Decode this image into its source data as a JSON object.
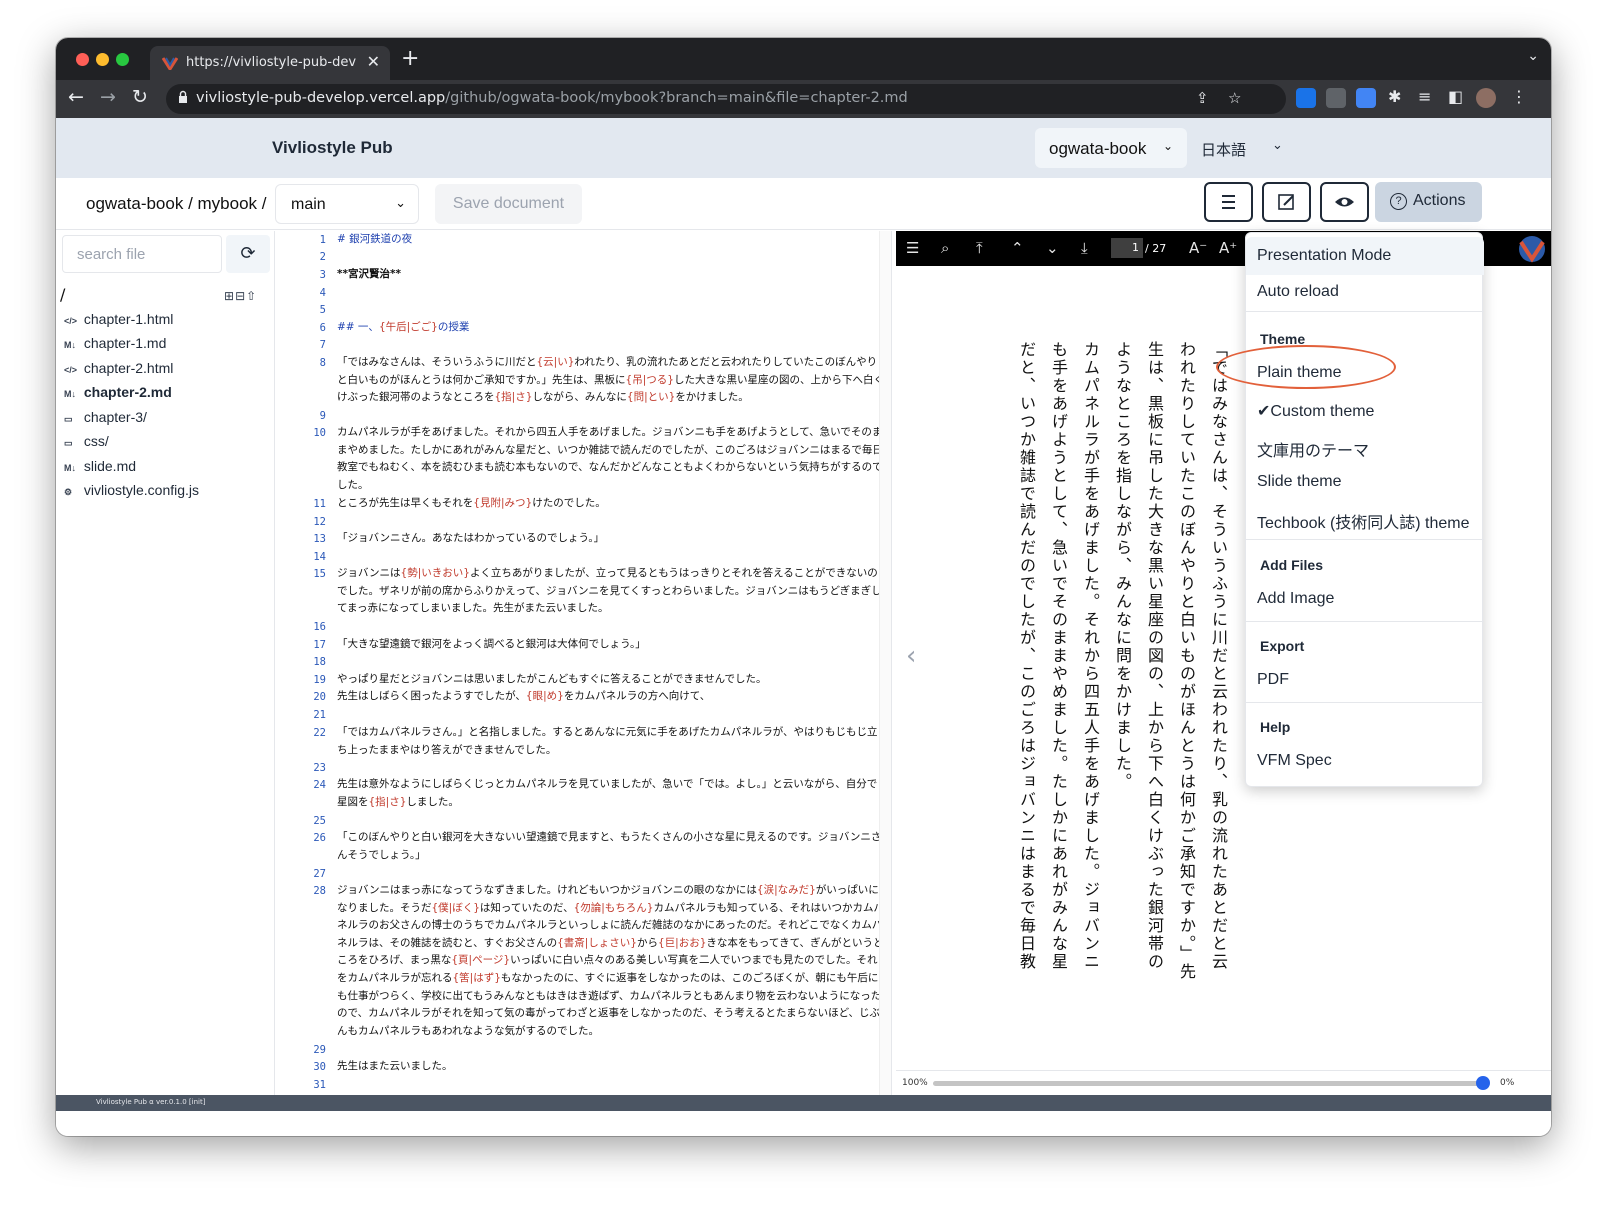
{
  "browser": {
    "tab_title": "https://vivliostyle-pub-develop",
    "tab_close": "✕",
    "new_tab": "+",
    "url_domain": "vivliostyle-pub-develop.vercel.app",
    "url_path": "/github/ogwata-book/mybook?branch=main&file=chapter-2.md"
  },
  "header": {
    "brand": "Vivliostyle Pub",
    "user": "ogwata-book",
    "language": "日本語"
  },
  "toolbar": {
    "repo_path": "ogwata-book / mybook /",
    "branch": "main",
    "save_label": "Save document",
    "actions_label": "Actions"
  },
  "sidebar": {
    "search_placeholder": "search file",
    "root": "/",
    "files": [
      {
        "name": "chapter-1.html",
        "icon": "</>"
      },
      {
        "name": "chapter-1.md",
        "icon": "M↓"
      },
      {
        "name": "chapter-2.html",
        "icon": "</>"
      },
      {
        "name": "chapter-2.md",
        "icon": "M↓"
      },
      {
        "name": "chapter-3/",
        "icon": "▭"
      },
      {
        "name": "css/",
        "icon": "▭"
      },
      {
        "name": "slide.md",
        "icon": "M↓"
      },
      {
        "name": "vivliostyle.config.js",
        "icon": "⚙"
      }
    ],
    "version": "Vivliostyle Pub α ver.0.1.0 [init]"
  },
  "editor": {
    "line_numbers": [
      "1",
      "2",
      "3",
      "4",
      "5",
      "6",
      "7",
      "8",
      "9",
      "10",
      "11",
      "12",
      "13",
      "14",
      "15",
      "16",
      "17",
      "18",
      "19",
      "20",
      "21",
      "22",
      "23",
      "24",
      "25",
      "26",
      "27",
      "28",
      "29",
      "30",
      "31"
    ],
    "lines": [
      "# 銀河鉄道の夜",
      "**宮沢賢治**",
      "## 一、{午后|ごご}の授業",
      "「ではみなさんは、そういうふうに川だと{云|い}われたり、乳の流れたあとだと云われたりしていたこのぼんやりと白いものがほんとうは何かご承知ですか。」先生は、黒板に{吊|つる}した大きな黒い星座の図の、上から下へ白くけぶった銀河帯のようなところを{指|さ}しながら、みんなに{問|とい}をかけました。",
      "カムパネルラが手をあげました。それから四五人手をあげました。ジョバンニも手をあげようとして、急いでそのままやめました。たしかにあれがみんな星だと、いつか雑誌で読んだのでしたが、このごろはジョバンニはまるで毎日教室でもねむく、本を読むひまも読む本もないので、なんだかどんなこともよくわからないという気持ちがするのでした。",
      "ところが先生は早くもそれを{見附|みつ}けたのでした。",
      "「ジョバンニさん。あなたはわかっているのでしょう。」",
      "ジョバンニは{勢|いきおい}よく立ちあがりましたが、立って見るともうはっきりとそれを答えることができないのでした。ザネリが前の席からふりかえって、ジョバンニを見てくすっとわらいました。ジョバンニはもうどぎまぎしてまっ赤になってしまいました。先生がまた云いました。",
      "「大きな望遠鏡で銀河をよっく調べると銀河は大体何でしょう。」",
      "やっぱり星だとジョバンニは思いましたがこんどもすぐに答えることができませんでした。",
      "先生はしばらく困ったようすでしたが、{眼|め}をカムパネルラの方へ向けて、",
      "「ではカムパネルラさん。」と名指しました。するとあんなに元気に手をあげたカムパネルラが、やはりもじもじ立ち上ったままやはり答えができませんでした。",
      "先生は意外なようにしばらくじっとカムパネルラを見ていましたが、急いで「では。よし。」と云いながら、自分で星図を{指|さ}しました。",
      "「このぼんやりと白い銀河を大きないい望遠鏡で見ますと、もうたくさんの小さな星に見えるのです。ジョバンニさんそうでしょう。」",
      "ジョバンニはまっ赤になってうなずきました。けれどもいつかジョバンニの眼のなかには{涙|なみだ}がいっぱいになりました。そうだ{僕|ぼく}は知っていたのだ、{勿論|もちろん}カムパネルラも知っている、それはいつかカムパネルラのお父さんの博士のうちでカムパネルラといっしょに読んだ雑誌のなかにあったのだ。それどこでなくカムパネルラは、その雑誌を読むと、すぐお父さんの{書斎|しょさい}から{巨|おお}きな本をもってきて、ぎんがというところをひろげ、まっ黒な{頁|ページ}いっぱいに白い点々のある美しい写真を二人でいつまでも見たのでした。それをカムパネルラが忘れる{筈|はず}もなかったのに、すぐに返事をしなかったのは、このごろぼくが、朝にも午后にも仕事がつらく、学校に出てもうみんなともはきはき遊ばず、カムパネルラともあんまり物を云わないようになったので、カムパネルラがそれを知って気の毒がってわざと返事をしなかったのだ、そう考えるとたまらないほど、じぶんもカムパネルラもあわれなような気がするのでした。",
      "先生はまた云いました。"
    ]
  },
  "viewer": {
    "page_current": "1",
    "page_total": "/ 27",
    "zoom_left": "100%",
    "zoom_right": "0%",
    "zoom_level": 1.0,
    "vertical_paragraphs": [
      "「ではみなさんは、そういうふうに川だと云われたり、乳の流れたあとだと云われたりしていたこのぼんやりと白いものがほんとうは何かご承知ですか。」先生は、黒板に吊した大きな黒い星座の図の、上から下へ白くけぶった銀河帯のようなところを指しながら、みんなに問をかけました。",
      "カムパネルラが手をあげました。それから四五人手をあげました。ジョバンニも手をあげようとして、急いでそのままやめました。たしかにあれがみんな星だと、いつか雑誌で読んだのでしたが、このごろはジョバンニはまるで毎日教室でもねむく、本を読むひまも読む本"
    ]
  },
  "actions_menu": {
    "presentation_mode": "Presentation Mode",
    "auto_reload": "Auto reload",
    "theme_header": "Theme",
    "themes": [
      "Plain theme",
      "Custom theme",
      "文庫用のテーマ",
      "Slide theme",
      "Techbook (技術同人誌) theme"
    ],
    "selected_mark": "✔",
    "add_files_header": "Add Files",
    "add_image": "Add Image",
    "export_header": "Export",
    "pdf": "PDF",
    "help_header": "Help",
    "vfm_spec": "VFM Spec"
  },
  "colors": {
    "header_bg": "#e2e8f0",
    "ruby_red": "#c0392b",
    "heading_blue": "#1e40af",
    "highlight_oval": "#e2603a"
  }
}
